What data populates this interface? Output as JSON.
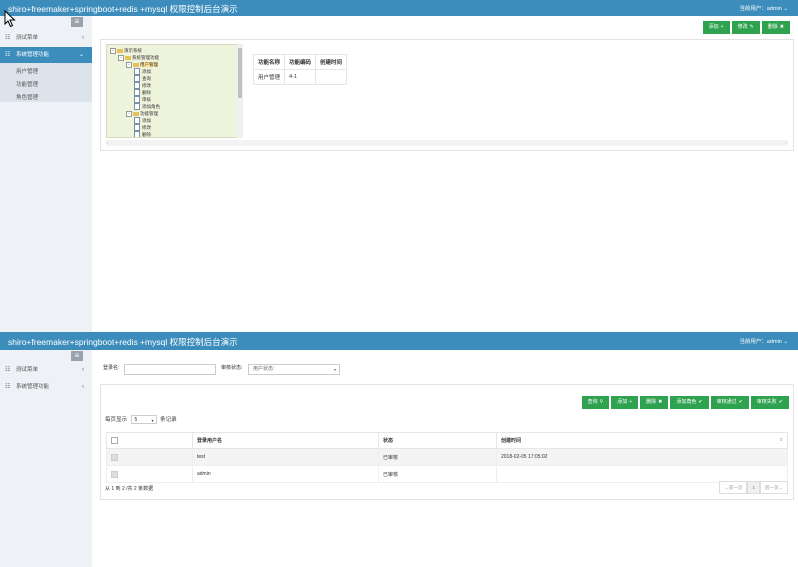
{
  "colors": {
    "header": "#3c8dbc",
    "action_button": "#2ea24f",
    "sidebar": "#eef1f5"
  },
  "screen1": {
    "title": "shiro+freemaker+springboot+redis +mysql 权限控制后台演示",
    "user_info": "当前用户：admin",
    "sidebar": {
      "collapse_icon": "hamburger-icon",
      "menu1": {
        "label": "测试菜单",
        "icon": "list-icon"
      },
      "menu2": {
        "label": "系统管理功能",
        "icon": "list-icon"
      },
      "submenu": [
        {
          "label": "用户管理"
        },
        {
          "label": "功能管理"
        },
        {
          "label": "角色管理"
        }
      ]
    },
    "toolbar": {
      "add": "添加",
      "add_icon": "plus-icon",
      "edit": "修改",
      "edit_icon": "edit-icon",
      "delete": "删除",
      "delete_icon": "close-icon"
    },
    "tree": [
      {
        "label": "演示系统",
        "level": 0,
        "toggle": "−",
        "type": "folder"
      },
      {
        "label": "系统管理功能",
        "level": 1,
        "toggle": "−",
        "type": "folder"
      },
      {
        "label": "用户管理",
        "level": 2,
        "toggle": "−",
        "type": "folder",
        "selected": true
      },
      {
        "label": "添加",
        "level": 3,
        "type": "doc"
      },
      {
        "label": "查询",
        "level": 3,
        "type": "doc"
      },
      {
        "label": "修改",
        "level": 3,
        "type": "doc"
      },
      {
        "label": "删除",
        "level": 3,
        "type": "doc"
      },
      {
        "label": "审核",
        "level": 3,
        "type": "doc"
      },
      {
        "label": "添加角色",
        "level": 3,
        "type": "doc"
      },
      {
        "label": "功能管理",
        "level": 2,
        "toggle": "−",
        "type": "folder"
      },
      {
        "label": "添加",
        "level": 3,
        "type": "doc"
      },
      {
        "label": "修改",
        "level": 3,
        "type": "doc"
      },
      {
        "label": "删除",
        "level": 3,
        "type": "doc"
      }
    ],
    "table": {
      "headers": [
        "功能名称",
        "功能编码",
        "创建时间"
      ],
      "rows": [
        [
          "用户管理",
          "4-1",
          ""
        ]
      ]
    }
  },
  "screen2": {
    "title": "shiro+freemaker+springboot+redis +mysql 权限控制后台演示",
    "user_info": "当前用户：admin",
    "sidebar": {
      "collapse_icon": "hamburger-icon",
      "menu1": {
        "label": "测试菜单",
        "icon": "list-icon"
      },
      "menu2": {
        "label": "系统管理功能",
        "icon": "list-icon"
      }
    },
    "filters": {
      "login_label": "登录名:",
      "login_value": "",
      "status_label": "审核状态:",
      "status_selected": "用户状态:"
    },
    "toolbar": {
      "query": "查询",
      "query_icon": "search-icon",
      "add": "添加",
      "add_icon": "plus-icon",
      "delete": "删除",
      "delete_icon": "close-icon",
      "add_role": "添加角色",
      "add_role_icon": "check-circle-icon",
      "approve": "审核通过",
      "approve_icon": "check-circle-icon",
      "reject": "审核失败",
      "reject_icon": "check-circle-icon"
    },
    "page_length": {
      "prefix": "每页显示",
      "value": "5",
      "suffix": "条记录"
    },
    "table": {
      "headers": [
        "",
        "登录用户名",
        "状态",
        "创建时间"
      ],
      "rows": [
        {
          "username": "test",
          "status": "已审核",
          "created": "2018-02-05 17:05:02"
        },
        {
          "username": "admin",
          "status": "已审核",
          "created": ""
        }
      ]
    },
    "table_info": "从 1 到 2 /共 2 条数据",
    "pager": {
      "prev": "←前一页",
      "page": "1",
      "next": "后一页→"
    }
  }
}
